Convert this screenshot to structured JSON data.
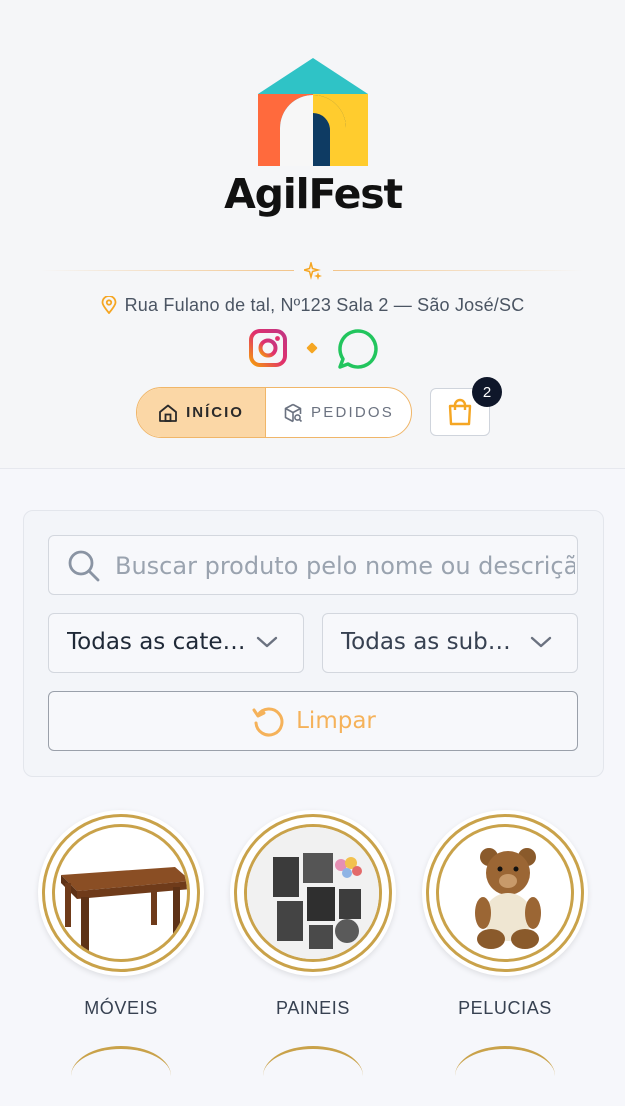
{
  "brand": {
    "name": "AgilFest"
  },
  "address": "Rua Fulano de tal, Nº123 Sala 2 — São José/SC",
  "nav": {
    "home_label": "INÍCIO",
    "orders_label": "PEDIDOS"
  },
  "cart": {
    "count": "2"
  },
  "filters": {
    "search_placeholder": "Buscar produto pelo nome ou descrição",
    "category_value": "Todas as categorias",
    "subcategory_value": "Todas as subcategorias",
    "clear_label": "Limpar"
  },
  "categories": [
    {
      "label": "MÓVEIS"
    },
    {
      "label": "PAINEIS"
    },
    {
      "label": "PELUCIAS"
    }
  ],
  "colors": {
    "accent": "#f5a623",
    "accent_light": "#fbd7a6",
    "gold": "#c9a24a",
    "dark": "#0f172a"
  }
}
